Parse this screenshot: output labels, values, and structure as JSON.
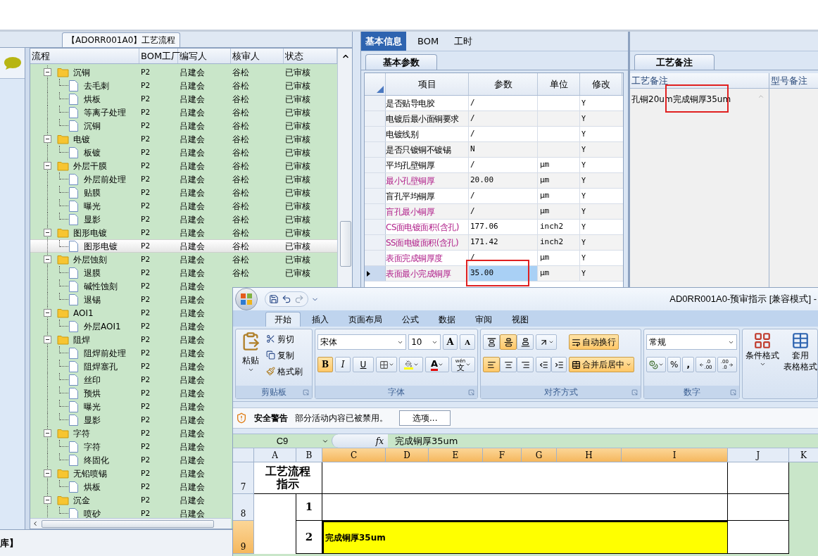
{
  "tree_panel": {
    "title": "【ADORR001A0】工艺流程",
    "columns": [
      "流程",
      "BOM工厂",
      "编写人",
      "核审人",
      "状态"
    ],
    "nodes": [
      {
        "name": "沉铜",
        "bom": "P2",
        "writer": "吕建会",
        "reviewer": "谷松",
        "status": "已审核",
        "selected": false,
        "children": [
          {
            "name": "去毛刺",
            "bom": "P2",
            "writer": "吕建会",
            "reviewer": "谷松",
            "status": "已审核",
            "selected": false
          },
          {
            "name": "烘板",
            "bom": "P2",
            "writer": "吕建会",
            "reviewer": "谷松",
            "status": "已审核",
            "selected": false
          },
          {
            "name": "等离子处理",
            "bom": "P2",
            "writer": "吕建会",
            "reviewer": "谷松",
            "status": "已审核",
            "selected": false
          },
          {
            "name": "沉铜",
            "bom": "P2",
            "writer": "吕建会",
            "reviewer": "谷松",
            "status": "已审核",
            "selected": false
          }
        ]
      },
      {
        "name": "电镀",
        "bom": "P2",
        "writer": "吕建会",
        "reviewer": "谷松",
        "status": "已审核",
        "selected": false,
        "children": [
          {
            "name": "板镀",
            "bom": "P2",
            "writer": "吕建会",
            "reviewer": "谷松",
            "status": "已审核",
            "selected": false
          }
        ]
      },
      {
        "name": "外层干膜",
        "bom": "P2",
        "writer": "吕建会",
        "reviewer": "谷松",
        "status": "已审核",
        "selected": false,
        "children": [
          {
            "name": "外层前处理",
            "bom": "P2",
            "writer": "吕建会",
            "reviewer": "谷松",
            "status": "已审核",
            "selected": false
          },
          {
            "name": "贴膜",
            "bom": "P2",
            "writer": "吕建会",
            "reviewer": "谷松",
            "status": "已审核",
            "selected": false
          },
          {
            "name": "曝光",
            "bom": "P2",
            "writer": "吕建会",
            "reviewer": "谷松",
            "status": "已审核",
            "selected": false
          },
          {
            "name": "显影",
            "bom": "P2",
            "writer": "吕建会",
            "reviewer": "谷松",
            "status": "已审核",
            "selected": false
          }
        ]
      },
      {
        "name": "图形电镀",
        "bom": "P2",
        "writer": "吕建会",
        "reviewer": "谷松",
        "status": "已审核",
        "selected": false,
        "children": [
          {
            "name": "图形电镀",
            "bom": "P2",
            "writer": "吕建会",
            "reviewer": "谷松",
            "status": "已审核",
            "selected": true
          }
        ]
      },
      {
        "name": "外层蚀刻",
        "bom": "P2",
        "writer": "吕建会",
        "reviewer": "谷松",
        "status": "已审核",
        "selected": false,
        "children": [
          {
            "name": "退膜",
            "bom": "P2",
            "writer": "吕建会",
            "reviewer": "谷松",
            "status": "已审核",
            "selected": false
          },
          {
            "name": "碱性蚀刻",
            "bom": "P2",
            "writer": "吕建会",
            "selected": false
          },
          {
            "name": "退锡",
            "bom": "P2",
            "writer": "吕建会",
            "selected": false
          }
        ]
      },
      {
        "name": "AOI1",
        "bom": "P2",
        "writer": "吕建会",
        "selected": false,
        "children": [
          {
            "name": "外层AOI1",
            "bom": "P2",
            "writer": "吕建会",
            "selected": false
          }
        ]
      },
      {
        "name": "阻焊",
        "bom": "P2",
        "writer": "吕建会",
        "selected": false,
        "children": [
          {
            "name": "阻焊前处理",
            "bom": "P2",
            "writer": "吕建会",
            "selected": false
          },
          {
            "name": "阻焊塞孔",
            "bom": "P2",
            "writer": "吕建会",
            "selected": false
          },
          {
            "name": "丝印",
            "bom": "P2",
            "writer": "吕建会",
            "selected": false
          },
          {
            "name": "预烘",
            "bom": "P2",
            "writer": "吕建会",
            "selected": false
          },
          {
            "name": "曝光",
            "bom": "P2",
            "writer": "吕建会",
            "selected": false
          },
          {
            "name": "显影",
            "bom": "P2",
            "writer": "吕建会",
            "selected": false
          }
        ]
      },
      {
        "name": "字符",
        "bom": "P2",
        "writer": "吕建会",
        "selected": false,
        "children": [
          {
            "name": "字符",
            "bom": "P2",
            "writer": "吕建会",
            "selected": false
          },
          {
            "name": "终固化",
            "bom": "P2",
            "writer": "吕建会",
            "selected": false
          }
        ]
      },
      {
        "name": "无铅喷锡",
        "bom": "P2",
        "writer": "吕建会",
        "selected": false,
        "children": [
          {
            "name": "烘板",
            "bom": "P2",
            "writer": "吕建会",
            "selected": false
          }
        ]
      },
      {
        "name": "沉金",
        "bom": "P2",
        "writer": "吕建会",
        "selected": false,
        "children": [
          {
            "name": "喷砂",
            "bom": "P2",
            "writer": "吕建会",
            "selected": false
          }
        ]
      }
    ]
  },
  "info_tabs": [
    {
      "label": "基本信息",
      "selected": true
    },
    {
      "label": "BOM",
      "selected": false
    },
    {
      "label": "工时",
      "selected": false
    }
  ],
  "params": {
    "tab": "基本参数",
    "columns": [
      "项目",
      "参数",
      "单位",
      "修改"
    ],
    "rows": [
      {
        "item": "是否贴导电胶",
        "value": "/",
        "modify": "Y",
        "emphasis": false,
        "selected": false,
        "marked": false
      },
      {
        "item": "电镀后最小面铜要求",
        "value": "/",
        "modify": "Y",
        "emphasis": false,
        "selected": false,
        "marked": false
      },
      {
        "item": "电镀线别",
        "value": "/",
        "modify": "Y",
        "emphasis": false,
        "selected": false,
        "marked": false
      },
      {
        "item": "是否只镀铜不镀锡",
        "value": "N",
        "modify": "Y",
        "emphasis": false,
        "selected": false,
        "marked": false
      },
      {
        "item": "平均孔壁铜厚",
        "value": "/",
        "unit": "μm",
        "modify": "Y",
        "emphasis": false,
        "selected": false,
        "marked": false
      },
      {
        "item": "最小孔壁铜厚",
        "value": "20.00",
        "unit": "μm",
        "modify": "Y",
        "emphasis": true,
        "selected": false,
        "marked": false
      },
      {
        "item": "盲孔平均铜厚",
        "value": "/",
        "unit": "μm",
        "modify": "Y",
        "emphasis": false,
        "selected": false,
        "marked": false
      },
      {
        "item": "盲孔最小铜厚",
        "value": "/",
        "unit": "μm",
        "modify": "Y",
        "emphasis": true,
        "selected": false,
        "marked": false
      },
      {
        "item": "CS面电镀面积(含孔)",
        "value": "177.06",
        "unit": "inch2",
        "modify": "Y",
        "emphasis": true,
        "selected": false,
        "marked": false
      },
      {
        "item": "SS面电镀面积(含孔)",
        "value": "171.42",
        "unit": "inch2",
        "modify": "Y",
        "emphasis": true,
        "selected": false,
        "marked": false
      },
      {
        "item": "表面完成铜厚度",
        "value": "/",
        "unit": "μm",
        "modify": "Y",
        "emphasis": true,
        "selected": false,
        "marked": false
      },
      {
        "item": "表面最小完成铜厚",
        "value": "35.00",
        "unit": "μm",
        "modify": "Y",
        "emphasis": true,
        "selected": true,
        "marked": true
      }
    ]
  },
  "notes": {
    "tab": "工艺备注",
    "columns": [
      "工艺备注",
      "型号备注"
    ],
    "note": "孔铜20um完成铜厚35um",
    "marked": true
  },
  "status_bar": {
    "text": "库】"
  },
  "excel": {
    "title": "AD0RR001A0-预审指示  [兼容模式]  -",
    "tabs": [
      {
        "label": "开始",
        "selected": true
      },
      {
        "label": "插入",
        "selected": false
      },
      {
        "label": "页面布局",
        "selected": false
      },
      {
        "label": "公式",
        "selected": false
      },
      {
        "label": "数据",
        "selected": false
      },
      {
        "label": "审阅",
        "selected": false
      },
      {
        "label": "视图",
        "selected": false
      }
    ],
    "clipboard": {
      "label": "剪贴板",
      "paste": "粘贴",
      "cut": "剪切",
      "copy": "复制",
      "painter": "格式刷"
    },
    "font": {
      "label": "字体",
      "name": "宋体",
      "pt": "10",
      "grow": "A",
      "shrink": "A",
      "bold": "B",
      "bold_on": true,
      "italic": "I",
      "italic_on": false,
      "underline": "U",
      "underline_on": false,
      "color_letter": "A",
      "phonetic_top": "wén",
      "phonetic_char": "文"
    },
    "alignment": {
      "label": "对齐方式",
      "vertical": [
        {
          "kind": "top",
          "selected": false
        },
        {
          "kind": "middle",
          "selected": true
        },
        {
          "kind": "bottom",
          "selected": false
        }
      ],
      "horizontal": [
        {
          "kind": "left",
          "selected": true
        },
        {
          "kind": "center",
          "selected": false
        },
        {
          "kind": "right",
          "selected": false
        }
      ],
      "wrap": {
        "label": "自动换行",
        "on": true
      },
      "merge": {
        "label": "合并后居中",
        "on": true
      }
    },
    "number": {
      "label": "数字",
      "format": "常规",
      "percent": "%",
      "comma": ",",
      "decimal_more": [
        ".0",
        ".00"
      ],
      "decimal_less": [
        ".00",
        ".0"
      ]
    },
    "styles": [
      {
        "kind": "conditional",
        "lines": [
          "条件格式"
        ]
      },
      {
        "kind": "table",
        "lines": [
          "套用",
          "表格格式"
        ]
      }
    ],
    "security": {
      "title": "安全警告",
      "message": "部分活动内容已被禁用。",
      "button": "选项..."
    },
    "formula_bar": {
      "name_box": "C9",
      "fx": "fx",
      "formula": "完成铜厚35um"
    },
    "columns": [
      {
        "label": "A",
        "selected": false
      },
      {
        "label": "B",
        "selected": false
      },
      {
        "label": "C",
        "selected": true
      },
      {
        "label": "D",
        "selected": true
      },
      {
        "label": "E",
        "selected": true
      },
      {
        "label": "F",
        "selected": true
      },
      {
        "label": "G",
        "selected": true
      },
      {
        "label": "H",
        "selected": true
      },
      {
        "label": "I",
        "selected": true
      },
      {
        "label": "J",
        "selected": false
      },
      {
        "label": "K",
        "selected": false
      }
    ],
    "rows": [
      {
        "header": "7",
        "selected": false,
        "title": "工艺流程指示",
        "highlighted": false
      },
      {
        "header": "8",
        "selected": false,
        "step": "1",
        "highlighted": false
      },
      {
        "header": "9",
        "selected": true,
        "step": "2",
        "content": "完成铜厚35um",
        "highlighted": true
      }
    ]
  }
}
